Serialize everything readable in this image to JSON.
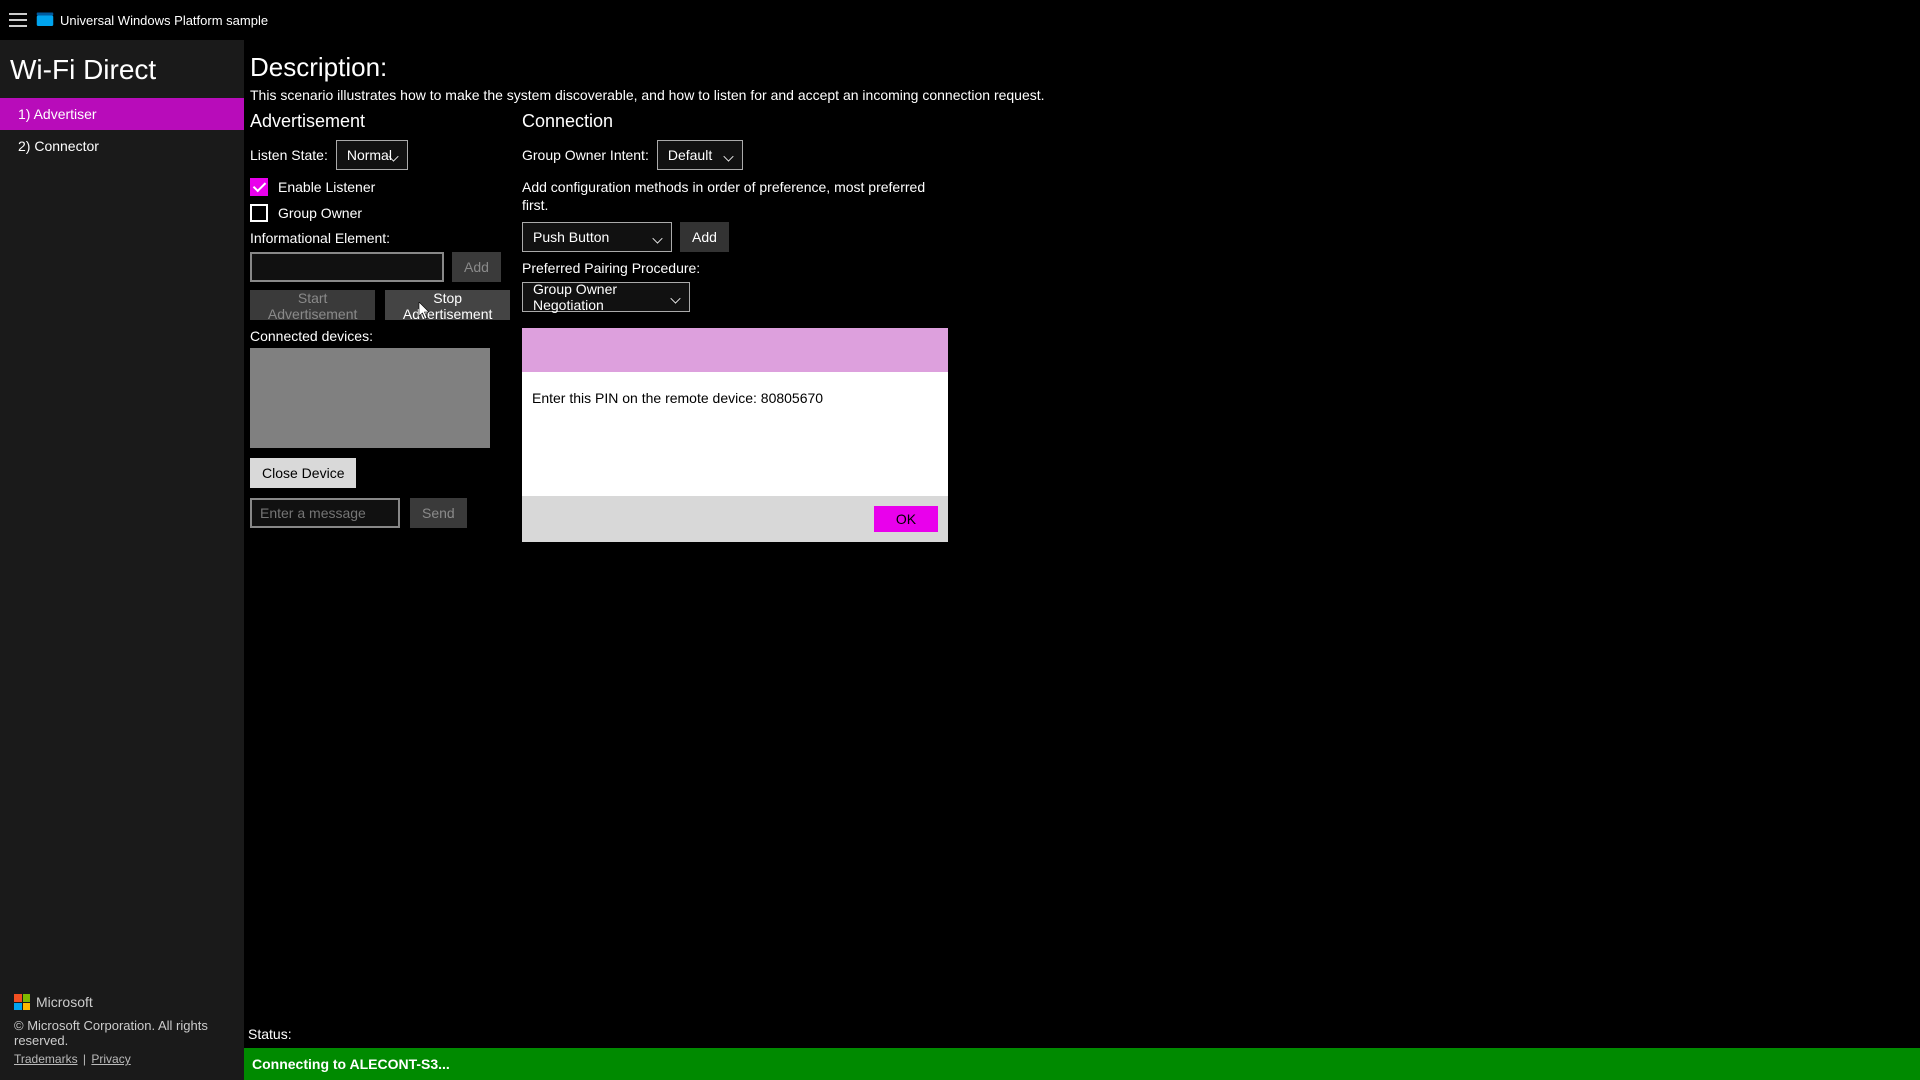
{
  "titlebar": {
    "app_title": "Universal Windows Platform sample"
  },
  "sidebar": {
    "title": "Wi-Fi Direct",
    "items": [
      {
        "label": "1) Advertiser",
        "active": true
      },
      {
        "label": "2) Connector",
        "active": false
      }
    ],
    "brand": "Microsoft",
    "copyright": "© Microsoft Corporation. All rights reserved.",
    "link_trademarks": "Trademarks",
    "link_privacy": "Privacy"
  },
  "description": {
    "heading": "Description:",
    "text": "This scenario illustrates how to make the system discoverable, and how to listen for and accept an incoming connection request."
  },
  "advertisement": {
    "title": "Advertisement",
    "listen_state_label": "Listen State:",
    "listen_state_value": "Normal",
    "enable_listener_label": "Enable Listener",
    "enable_listener_checked": true,
    "group_owner_label": "Group Owner",
    "group_owner_checked": false,
    "info_element_label": "Informational Element:",
    "info_element_value": "",
    "add_button": "Add",
    "start_button": "Start Advertisement",
    "stop_button": "Stop Advertisement",
    "connected_devices_label": "Connected devices:",
    "close_device_button": "Close Device",
    "message_placeholder": "Enter a message",
    "send_button": "Send"
  },
  "connection": {
    "title": "Connection",
    "gown_intent_label": "Group Owner Intent:",
    "gown_intent_value": "Default",
    "config_note": "Add configuration methods in order of preference, most preferred first.",
    "config_method_value": "Push Button",
    "add_button": "Add",
    "preferred_pairing_label": "Preferred Pairing Procedure:",
    "preferred_pairing_value": "Group Owner Negotiation"
  },
  "dialog": {
    "message_prefix": "Enter this PIN on the remote device: ",
    "pin": "80805670",
    "ok_label": "OK"
  },
  "status": {
    "label": "Status:",
    "message": "Connecting to ALECONT-S3..."
  }
}
